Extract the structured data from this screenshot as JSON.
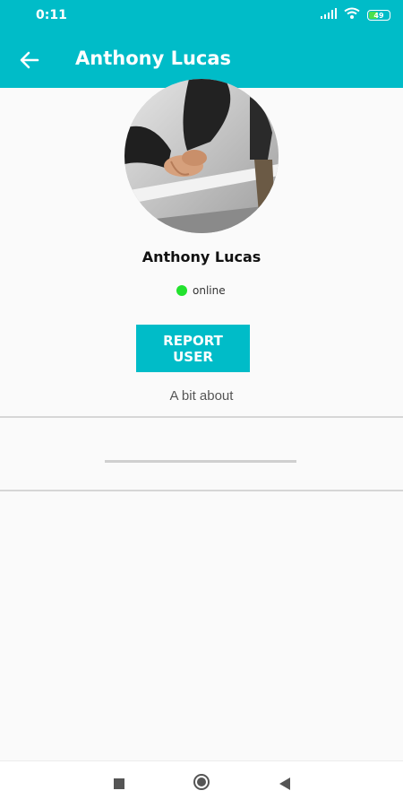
{
  "status_bar": {
    "time": "0:11",
    "battery_level": "49",
    "battery_fraction": 0.49,
    "signal_icon": "signal-icon",
    "wifi_icon": "wifi-icon",
    "battery_icon": "battery-icon"
  },
  "app_bar": {
    "title": "Anthony Lucas",
    "back_icon": "arrow-left-icon"
  },
  "profile": {
    "avatar": "holding-hands-photo",
    "name": "Anthony Lucas",
    "status": "online",
    "status_color": "#22e22e"
  },
  "actions": {
    "report_label": "REPORT USER"
  },
  "about": {
    "label": "A bit about",
    "text": ""
  },
  "nav_bar": {
    "recents_icon": "square-icon",
    "home_icon": "circle-icon",
    "back_icon": "triangle-back-icon"
  },
  "colors": {
    "accent": "#00bcc8",
    "background": "#fafafa"
  }
}
